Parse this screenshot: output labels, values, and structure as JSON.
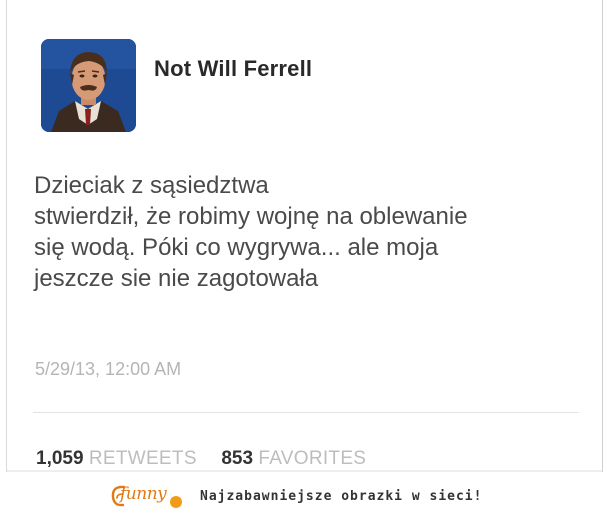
{
  "tweet": {
    "display_name": "Not Will Ferrell",
    "avatar_icon": "profile-photo",
    "text_lines": [
      "Dzieciak z sąsiedztwa",
      "stwierdził, że robimy wojnę na oblewanie",
      "się wodą. Póki co wygrywa... ale moja",
      "jeszcze sie nie zagotowała"
    ],
    "timestamp": "5/29/13, 12:00 AM",
    "retweets_count": "1,059",
    "retweets_label": "RETWEETS",
    "favorites_count": "853",
    "favorites_label": "FAVORITES"
  },
  "footer": {
    "logo_text": "funny",
    "tagline": "Najzabawniejsze obrazki w sieci!",
    "brand_color": "#e07a12"
  }
}
